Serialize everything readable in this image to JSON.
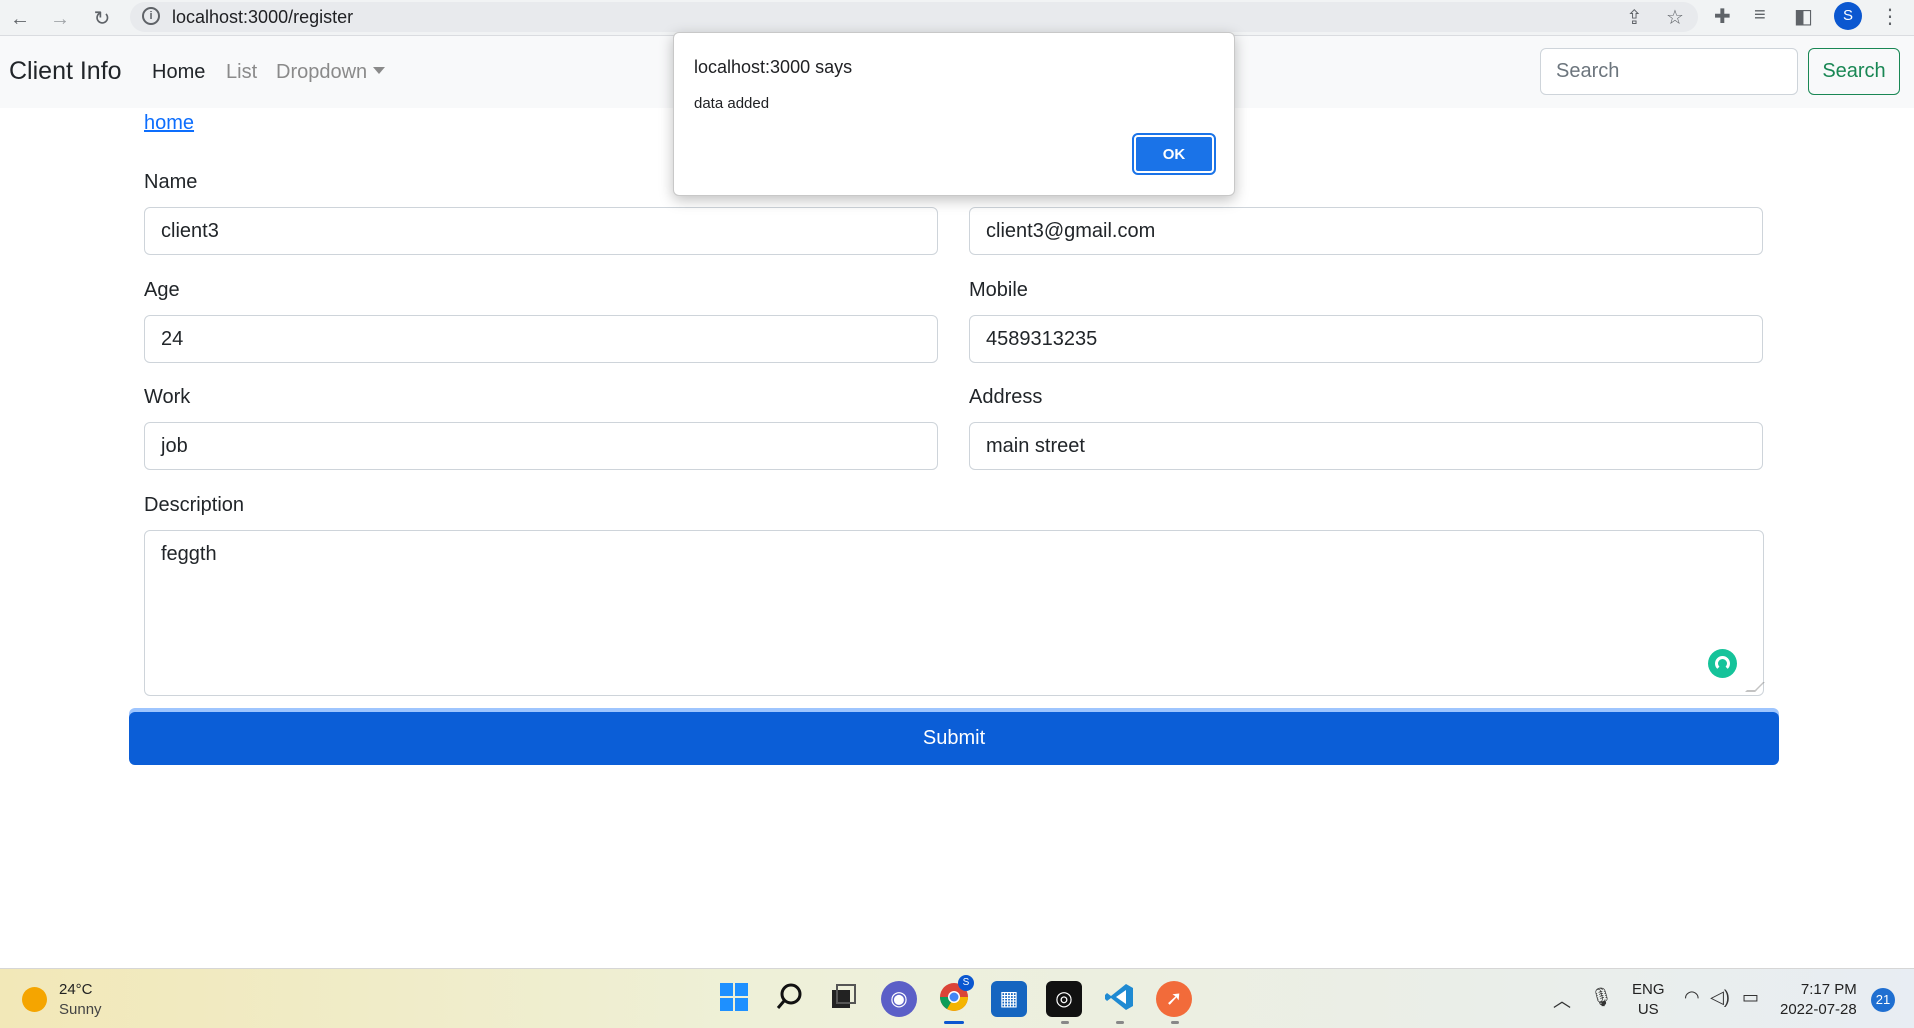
{
  "browser": {
    "url": "localhost:3000/register",
    "profile_initial": "S"
  },
  "navbar": {
    "brand": "Client Info",
    "links": [
      {
        "label": "Home",
        "active": true
      },
      {
        "label": "List",
        "active": false
      },
      {
        "label": "Dropdown",
        "active": false
      }
    ],
    "search_placeholder": "Search",
    "search_button": "Search"
  },
  "form": {
    "home_link": "home",
    "name_label": "Name",
    "name_value": "client3",
    "email_value": "client3@gmail.com",
    "age_label": "Age",
    "age_value": "24",
    "mobile_label": "Mobile",
    "mobile_value": "4589313235",
    "work_label": "Work",
    "work_value": "job",
    "address_label": "Address",
    "address_value": "main street",
    "description_label": "Description",
    "description_value": "feggth",
    "submit_label": "Submit"
  },
  "alert": {
    "title": "localhost:3000 says",
    "message": "data added",
    "ok_label": "OK"
  },
  "taskbar": {
    "weather_temp": "24°C",
    "weather_condition": "Sunny",
    "lang_line1": "ENG",
    "lang_line2": "US",
    "time": "7:17 PM",
    "date": "2022-07-28",
    "notification_count": "21",
    "chrome_badge": "S"
  },
  "colors": {
    "primary": "#0b5ed7",
    "success": "#198754",
    "link": "#0d6efd",
    "dialog_ok": "#1a73e8"
  }
}
